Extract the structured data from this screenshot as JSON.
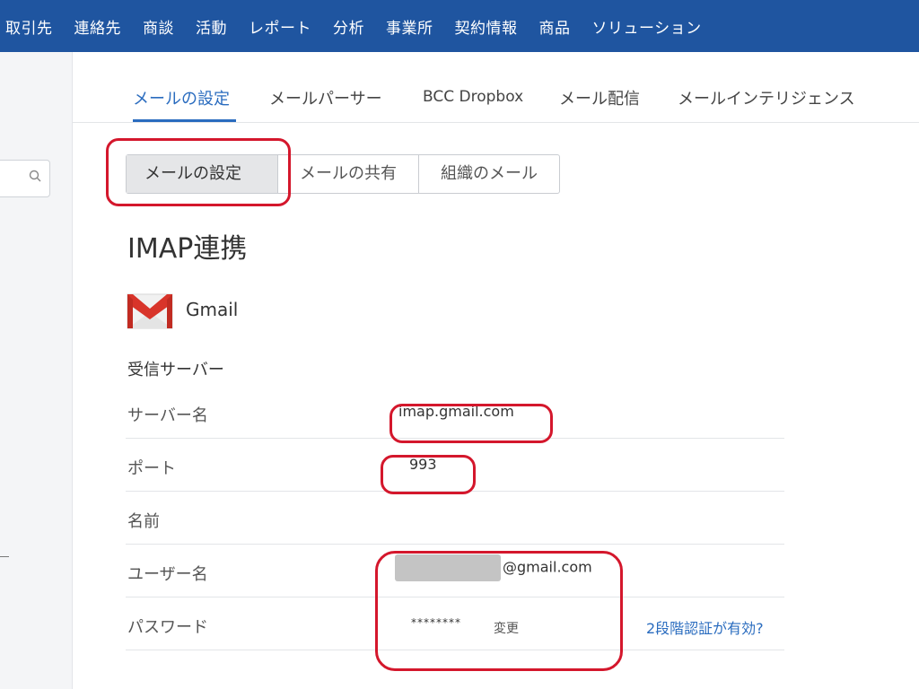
{
  "top_nav": [
    "取引先",
    "連絡先",
    "商談",
    "活動",
    "レポート",
    "分析",
    "事業所",
    "契約情報",
    "商品",
    "ソリューション"
  ],
  "tabs": [
    {
      "label": "メールの設定",
      "active": true
    },
    {
      "label": "メールパーサー",
      "active": false
    },
    {
      "label": "BCC Dropbox",
      "active": false
    },
    {
      "label": "メール配信",
      "active": false
    },
    {
      "label": "メールインテリジェンス",
      "active": false
    }
  ],
  "segmented": [
    {
      "label": "メールの設定",
      "active": true
    },
    {
      "label": "メールの共有",
      "active": false
    },
    {
      "label": "組織のメール",
      "active": false
    }
  ],
  "heading": "IMAP連携",
  "provider": {
    "name": "Gmail",
    "icon": "gmail-icon"
  },
  "section": "受信サーバー",
  "fields": {
    "server": {
      "label": "サーバー名",
      "value": "imap.gmail.com"
    },
    "port": {
      "label": "ポート",
      "value": "993"
    },
    "name": {
      "label": "名前",
      "value": ""
    },
    "username": {
      "label": "ユーザー名",
      "domain": "@gmail.com"
    },
    "password": {
      "label": "パスワード",
      "masked": "********",
      "change_label": "変更",
      "two_step_link": "2段階認証が有効?"
    }
  },
  "colors": {
    "nav_bg": "#1f55a0",
    "accent": "#2a6cbf",
    "annotation": "#d4172c"
  }
}
